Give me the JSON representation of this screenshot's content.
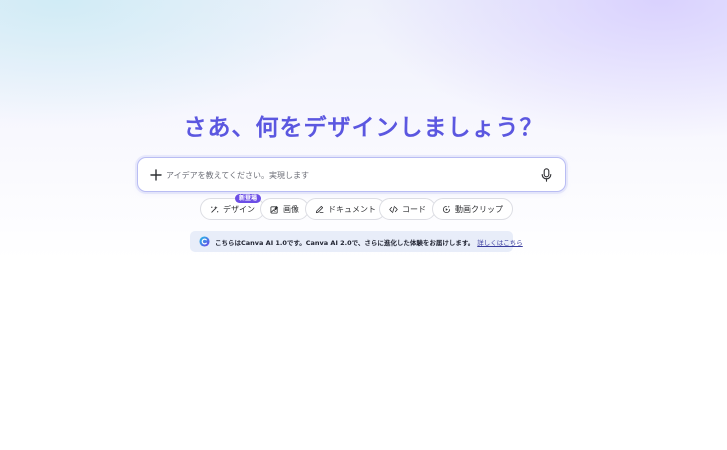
{
  "headline": "さあ、何をデザインしましょう？",
  "prompt": {
    "placeholder": "アイデアを教えてください。実現します",
    "value": ""
  },
  "chips": [
    {
      "label": "デザイン",
      "icon": "sparkle-icon",
      "badge": "新登場"
    },
    {
      "label": "画像",
      "icon": "image-edit-icon"
    },
    {
      "label": "ドキュメント",
      "icon": "pen-doc-icon"
    },
    {
      "label": "コード",
      "icon": "code-icon"
    },
    {
      "label": "動画クリップ",
      "icon": "video-clip-icon"
    }
  ],
  "notice": {
    "text": "こちらはCanva AI 1.0です。Canva AI 2.0で、さらに進化した体験をお届けします。",
    "link": "詳しくはこちら"
  },
  "colors": {
    "accent": "#5b57e0",
    "badge": "#6c4ee6",
    "notice_bg": "#e8edf9"
  }
}
